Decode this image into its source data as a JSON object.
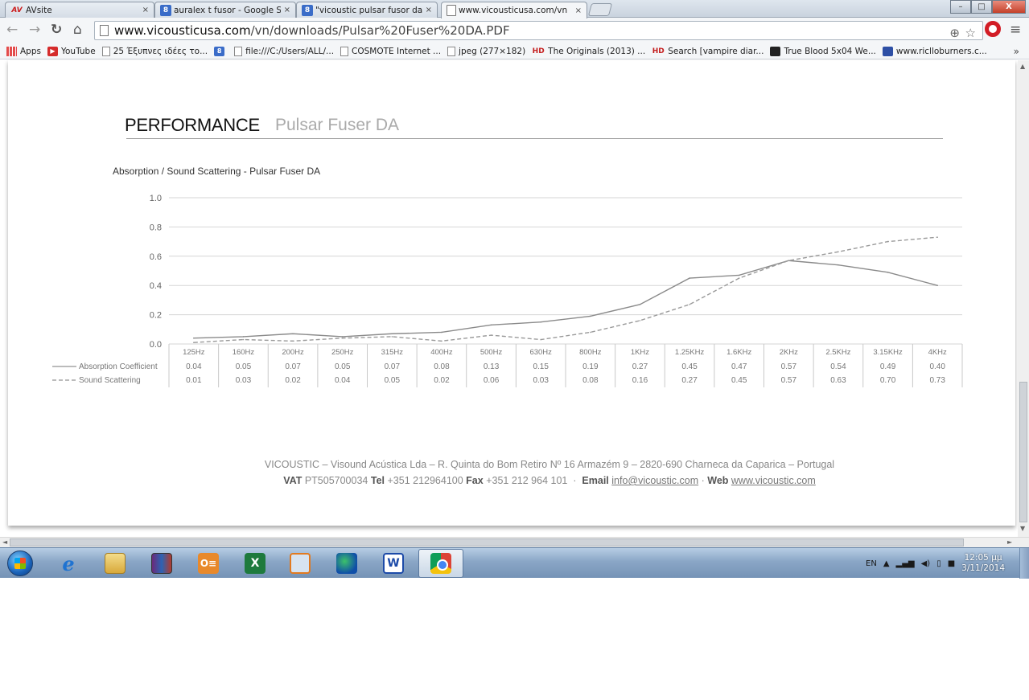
{
  "browser": {
    "tabs": [
      {
        "icon": "AV",
        "label": "AVsite",
        "active": false
      },
      {
        "icon": "8",
        "label": "auralex t fusor - Google Se",
        "active": false
      },
      {
        "icon": "8",
        "label": "\"vicoustic pulsar fusor da\"",
        "active": false
      },
      {
        "icon": "page",
        "label": "www.vicousticusa.com/vn",
        "active": true
      }
    ],
    "close_glyph": "×",
    "window_buttons": {
      "minimize": "–",
      "maximize": "□",
      "close": "X"
    },
    "url_domain": "www.vicousticusa.com",
    "url_path": "/vn/downloads/Pulsar%20Fuser%20DA.PDF"
  },
  "bookmarks": [
    {
      "icon": "apps",
      "label": "Apps"
    },
    {
      "icon": "youtube",
      "label": "YouTube"
    },
    {
      "icon": "page",
      "label": "25 Έξυπνες ιδέες το..."
    },
    {
      "icon": "google",
      "label": ""
    },
    {
      "icon": "page",
      "label": "file:///C:/Users/ALL/..."
    },
    {
      "icon": "page",
      "label": "COSMOTE Internet ..."
    },
    {
      "icon": "page",
      "label": "jpeg (277×182)"
    },
    {
      "icon": "hd",
      "label": "The Originals (2013) ..."
    },
    {
      "icon": "hd",
      "label": "Search [vampire diar..."
    },
    {
      "icon": "tv",
      "label": "True Blood 5x04 We..."
    },
    {
      "icon": "rb",
      "label": "www.riclloburners.c..."
    }
  ],
  "bookmarks_more": "»",
  "document": {
    "heading": "PERFORMANCE",
    "product": "Pulsar Fuser DA",
    "chart_title": "Absorption / Sound Scattering - Pulsar Fuser  DA",
    "footer_line1": "VICOUSTIC – Visound Acústica Lda – R. Quinta do Bom Retiro Nº 16 Armazém 9 – 2820-690 Charneca da Caparica – Portugal",
    "footer_vat_label": "VAT",
    "footer_vat": "PT505700034",
    "footer_tel_label": "Tel",
    "footer_tel": "+351 212964100",
    "footer_fax_label": "Fax",
    "footer_fax": "+351 212 964 101",
    "footer_email_label": "Email",
    "footer_email": "info@vicoustic.com",
    "footer_web_label": "Web",
    "footer_web": "www.vicoustic.com"
  },
  "chart_data": {
    "type": "line",
    "title": "Absorption / Sound Scattering - Pulsar Fuser  DA",
    "categories": [
      "125Hz",
      "160Hz",
      "200Hz",
      "250Hz",
      "315Hz",
      "400Hz",
      "500Hz",
      "630Hz",
      "800Hz",
      "1KHz",
      "1.25KHz",
      "1.6KHz",
      "2KHz",
      "2.5KHz",
      "3.15KHz",
      "4KHz"
    ],
    "y_ticks": [
      "1.0",
      "0.8",
      "0.6",
      "0.4",
      "0.2",
      "0.0"
    ],
    "ylim": [
      0,
      1.0
    ],
    "grid": true,
    "legend_position": "bottom-left table",
    "series": [
      {
        "name": "Absorption Coefficient",
        "style": "solid",
        "values": [
          0.04,
          0.05,
          0.07,
          0.05,
          0.07,
          0.08,
          0.13,
          0.15,
          0.19,
          0.27,
          0.45,
          0.47,
          0.57,
          0.54,
          0.49,
          0.4
        ],
        "labels": [
          "0.04",
          "0.05",
          "0.07",
          "0.05",
          "0.07",
          "0.08",
          "0.13",
          "0.15",
          "0.19",
          "0.27",
          "0.45",
          "0.47",
          "0.57",
          "0.54",
          "0.49",
          "0.40"
        ]
      },
      {
        "name": "Sound Scattering",
        "style": "dashed",
        "values": [
          0.01,
          0.03,
          0.02,
          0.04,
          0.05,
          0.02,
          0.06,
          0.03,
          0.08,
          0.16,
          0.27,
          0.45,
          0.57,
          0.63,
          0.7,
          0.73
        ],
        "labels": [
          "0.01",
          "0.03",
          "0.02",
          "0.04",
          "0.05",
          "0.02",
          "0.06",
          "0.03",
          "0.08",
          "0.16",
          "0.27",
          "0.45",
          "0.57",
          "0.63",
          "0.70",
          "0.73"
        ]
      }
    ],
    "colors": {
      "absorption": "#8a8a8a",
      "scattering": "#9a9a9a",
      "grid": "#d6d6d6"
    }
  },
  "taskbar": {
    "apps": [
      "internet-explorer",
      "file-explorer",
      "winrar",
      "people",
      "excel",
      "media",
      "globe",
      "word",
      "chrome"
    ],
    "tray": {
      "lang": "EN",
      "time": "12:05 μμ",
      "date": "3/11/2014"
    }
  }
}
